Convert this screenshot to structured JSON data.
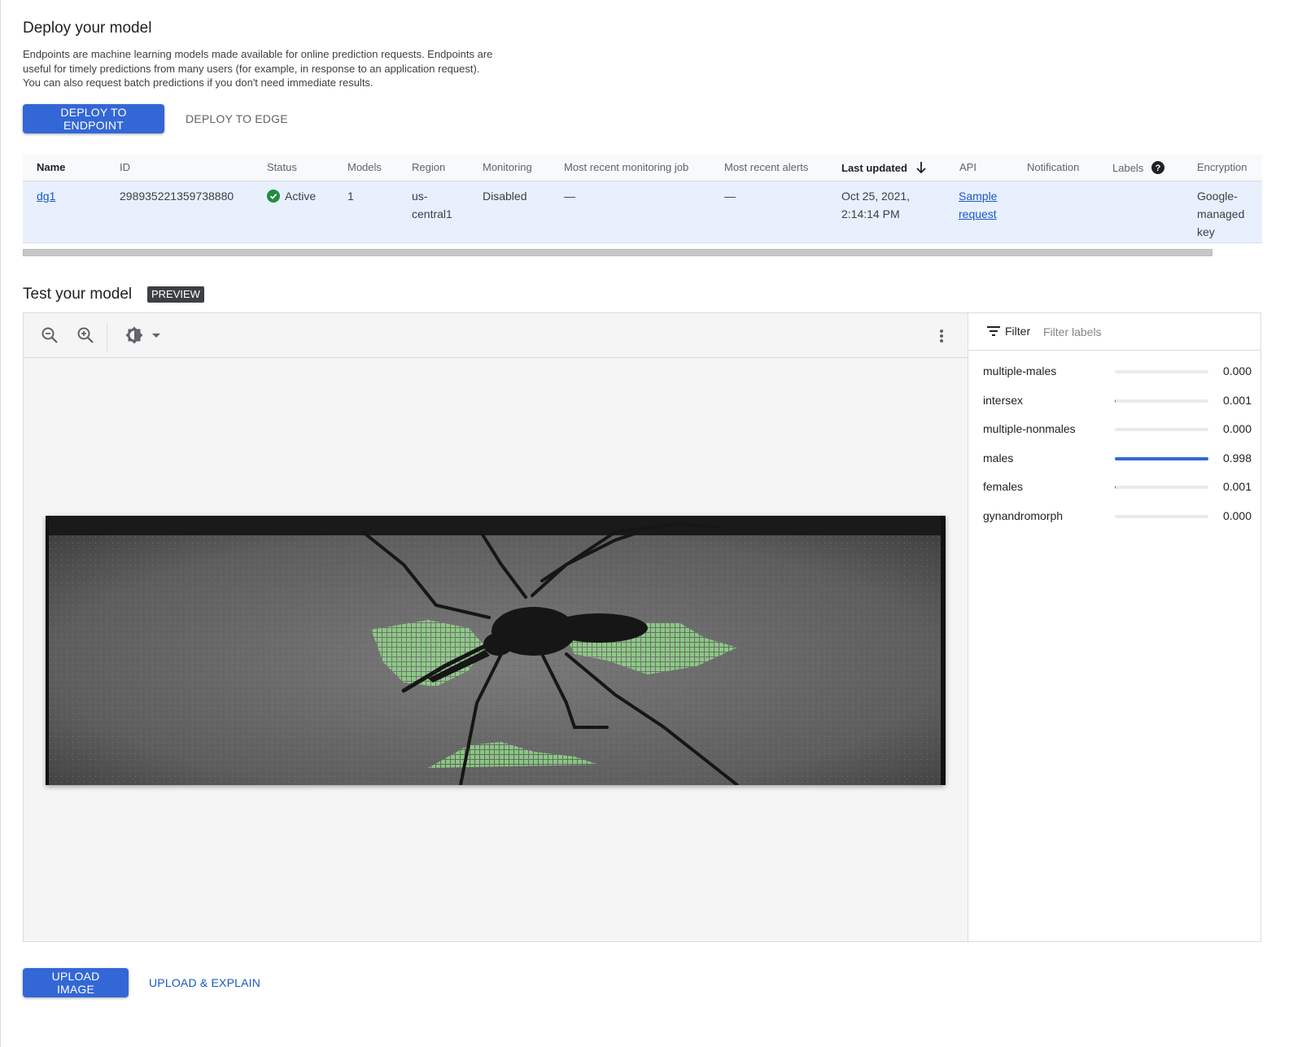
{
  "deploy": {
    "title": "Deploy your model",
    "description": "Endpoints are machine learning models made available for online prediction requests. Endpoints are useful for timely predictions from many users (for example, in response to an application request). You can also request batch predictions if you don't need immediate results.",
    "deploy_endpoint_label": "DEPLOY TO ENDPOINT",
    "deploy_edge_label": "DEPLOY TO EDGE"
  },
  "table": {
    "headers": {
      "name": "Name",
      "id": "ID",
      "status": "Status",
      "models": "Models",
      "region": "Region",
      "monitoring": "Monitoring",
      "recent_job": "Most recent monitoring job",
      "recent_alerts": "Most recent alerts",
      "last_updated": "Last updated",
      "api": "API",
      "notification": "Notification",
      "labels": "Labels",
      "encryption": "Encryption"
    },
    "row": {
      "name": "dg1",
      "id": "2989352213597388 80",
      "id_full": "298935221359738880",
      "status": "Active",
      "models": "1",
      "region_line1": "us-",
      "region_line2": "central1",
      "monitoring": "Disabled",
      "recent_job": "—",
      "recent_alerts": "—",
      "last_updated_line1": "Oct 25, 2021,",
      "last_updated_line2": "2:14:14 PM",
      "api_line1": "Sample",
      "api_line2": "request",
      "encryption_line1": "Google-",
      "encryption_line2": "managed",
      "encryption_line3": "key"
    }
  },
  "test": {
    "title": "Test your model",
    "badge": "PREVIEW",
    "toolbar_icons": [
      "zoom-out-icon",
      "zoom-in-icon",
      "brightness-icon",
      "dropdown-arrow-icon",
      "more-vert-icon"
    ],
    "filter_label": "Filter",
    "filter_placeholder": "Filter labels",
    "labels": [
      {
        "name": "multiple-males",
        "value": "0.000",
        "score": 0.0
      },
      {
        "name": "intersex",
        "value": "0.001",
        "score": 0.001
      },
      {
        "name": "multiple-nonmales",
        "value": "0.000",
        "score": 0.0
      },
      {
        "name": "males",
        "value": "0.998",
        "score": 0.998
      },
      {
        "name": "females",
        "value": "0.001",
        "score": 0.001
      },
      {
        "name": "gynandromorph",
        "value": "0.000",
        "score": 0.0
      }
    ],
    "upload_image_label": "UPLOAD IMAGE",
    "upload_explain_label": "UPLOAD & EXPLAIN"
  },
  "colors": {
    "primary": "#3367d6",
    "link": "#1a57c4",
    "active_green": "#1e8e3e",
    "overlay_green": "#8ee58a"
  }
}
